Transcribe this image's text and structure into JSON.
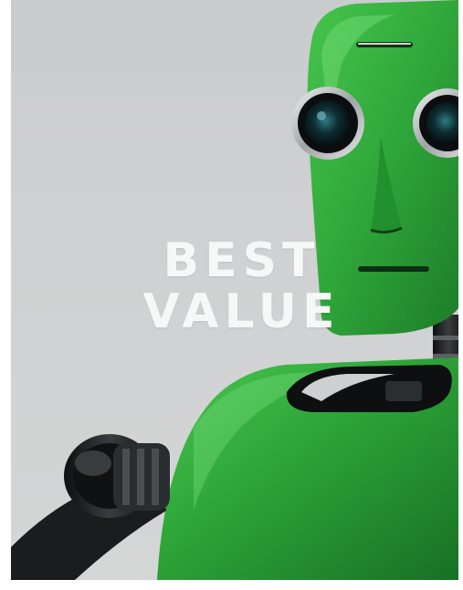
{
  "headline": {
    "line1": "BEST",
    "line2": "VALUE"
  },
  "colors": {
    "background": "#cfd1d2",
    "robot_green": "#2fa63a",
    "robot_dark": "#1d1f21",
    "text": "#f6f7f7"
  },
  "subject": {
    "icon": "green-robot-illustration"
  }
}
